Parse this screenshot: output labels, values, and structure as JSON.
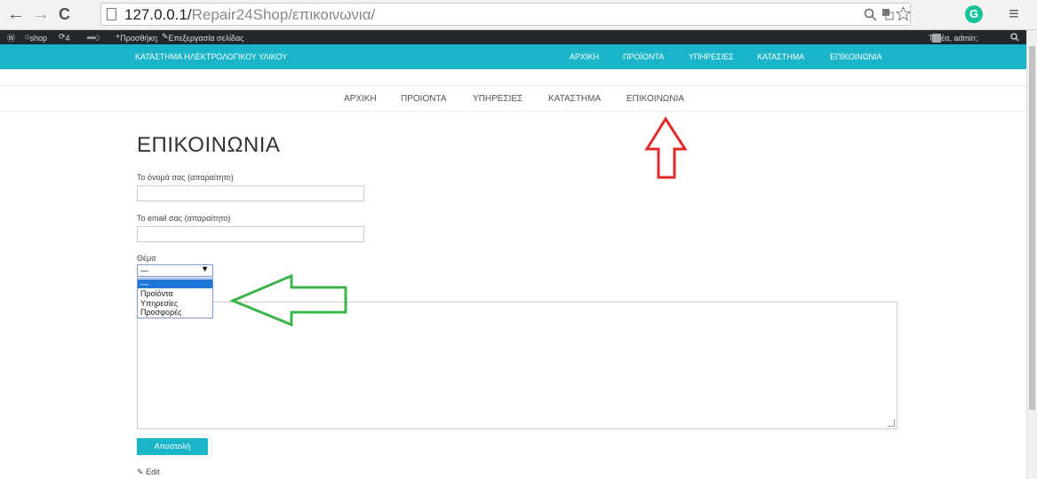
{
  "browser": {
    "url_host": "127.0.0.1/",
    "url_path": "Repair24Shop/επικοινωνια/",
    "back_icon": "←",
    "forward_icon": "→",
    "reload_icon": "C",
    "menu_icon": "≡"
  },
  "adminbar": {
    "site": "shop",
    "updates": "4",
    "comments": "0",
    "new_label": "Προσθήκη",
    "edit_page": "Επεξεργασία σελίδας",
    "greeting": "Τι νέα, admin;"
  },
  "site": {
    "title": "ΚΑΤΑΣΤΗΜΑ ΗΛΕΚΤΡΟΛΟΓΙΚΟΥ ΥΛΙΚΟΥ",
    "top_menu": [
      "ΑΡΧΙΚΗ",
      "ΠΡΟΪΟΝΤΑ",
      "ΥΠΗΡΕΣΙΕΣ",
      "ΚΑΤΑΣΤΗΜΑ",
      "ΕΠΙΚΟΙΝΩΝΙΑ"
    ],
    "sub_menu": [
      "ΑΡΧΙΚΗ",
      "ΠΡΟΙΟΝΤΑ",
      "ΥΠΗΡΕΣΙΕΣ",
      "ΚΑΤΑΣΤΗΜΑ",
      "ΕΠΙΚΟΙΝΩΝΙΑ"
    ]
  },
  "form": {
    "heading": "ΕΠΙΚΟΙΝΩΝΙΑ",
    "name_label": "Το όνομά σας (απαραίτητο)",
    "email_label": "Το email σας (απαραίτητο)",
    "subject_label": "Θέμα",
    "subject_selected": "—",
    "subject_options": [
      "—",
      "Προϊόντα",
      "Υπηρεσίες",
      "Προσφορές"
    ],
    "submit_label": "Αποστολή",
    "edit_label": "Edit"
  },
  "colors": {
    "accent": "#1ab5c9",
    "adminbar": "#23282d",
    "red_arrow": "#e32a2a",
    "green_arrow": "#3cb44b"
  }
}
